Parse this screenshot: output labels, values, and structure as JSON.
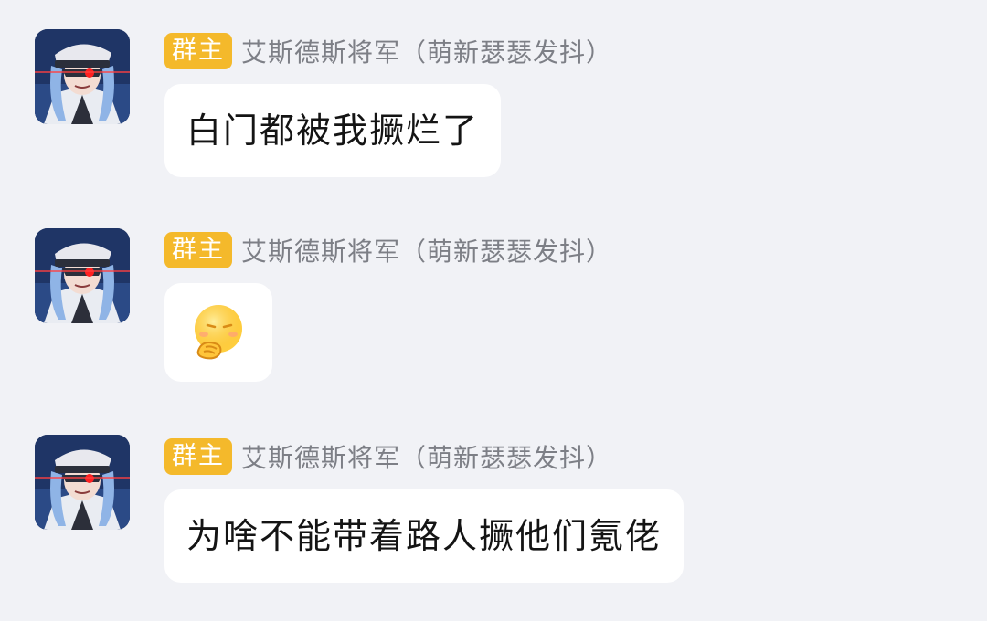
{
  "messages": [
    {
      "badge": "群主",
      "sender": "艾斯德斯将军（萌新瑟瑟发抖）",
      "text": "白门都被我撅烂了",
      "avatar_icon": "anime-officer-avatar-icon"
    },
    {
      "badge": "群主",
      "sender": "艾斯德斯将军（萌新瑟瑟发抖）",
      "sticker_icon": "thinking-face-emoji-icon",
      "avatar_icon": "anime-officer-avatar-icon"
    },
    {
      "badge": "群主",
      "sender": "艾斯德斯将军（萌新瑟瑟发抖）",
      "text": "为啥不能带着路人撅他们氪佬",
      "avatar_icon": "anime-officer-avatar-icon"
    }
  ],
  "colors": {
    "background": "#f1f2f6",
    "badge": "#f4b92b",
    "nickname": "#7d7f86",
    "bubble": "#ffffff"
  }
}
